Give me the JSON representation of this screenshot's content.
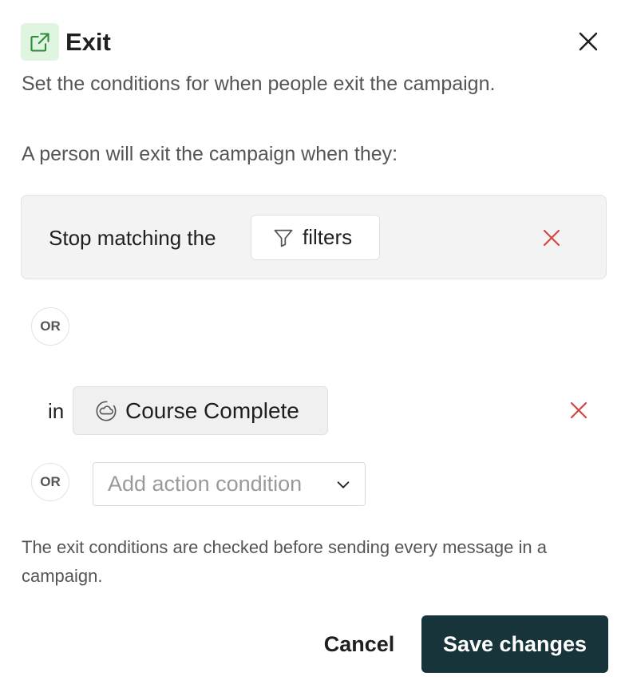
{
  "header": {
    "title": "Exit",
    "icon": "external-link-icon",
    "close_icon": "close-icon",
    "accent_bg": "#dff5df",
    "accent_fg": "#2e8b3a"
  },
  "description": "Set the conditions for when people exit the campaign.",
  "conditions_intro": "A person will exit the campaign when they:",
  "filter_condition": {
    "prefix": "Stop matching the",
    "button_label": "filters",
    "button_icon": "filter-funnel-icon",
    "remove_icon": "remove-x-icon"
  },
  "or_label": "OR",
  "event_condition": {
    "prefix": "in",
    "event_label": "Course Complete",
    "event_icon": "event-segment-icon",
    "remove_icon": "remove-x-icon"
  },
  "add_condition": {
    "placeholder": "Add action condition",
    "icon": "chevron-down-icon"
  },
  "note": "The exit conditions are checked before sending every message in a campaign.",
  "footer": {
    "cancel_label": "Cancel",
    "save_label": "Save changes",
    "save_bg": "#17343a"
  },
  "colors": {
    "remove_x": "#d64545"
  }
}
